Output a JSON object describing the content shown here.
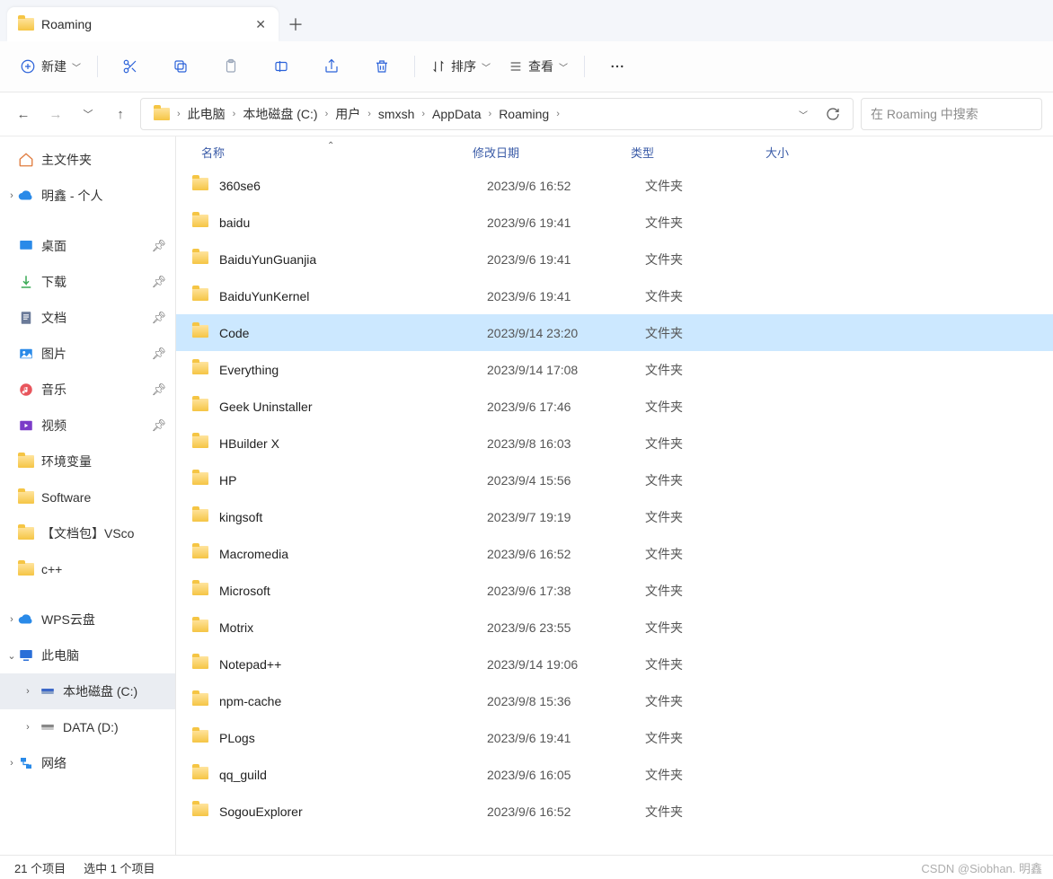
{
  "tab": {
    "title": "Roaming"
  },
  "toolbar": {
    "new": "新建",
    "sort": "排序",
    "view": "查看"
  },
  "breadcrumb": {
    "segments": [
      "此电脑",
      "本地磁盘 (C:)",
      "用户",
      "smxsh",
      "AppData",
      "Roaming"
    ]
  },
  "search": {
    "placeholder": "在 Roaming 中搜索"
  },
  "columns": {
    "name": "名称",
    "date": "修改日期",
    "type": "类型",
    "size": "大小"
  },
  "nav": {
    "home": "主文件夹",
    "personal": "明鑫 - 个人",
    "quick": [
      {
        "label": "桌面",
        "pinned": true
      },
      {
        "label": "下载",
        "pinned": true
      },
      {
        "label": "文档",
        "pinned": true
      },
      {
        "label": "图片",
        "pinned": true
      },
      {
        "label": "音乐",
        "pinned": true
      },
      {
        "label": "视频",
        "pinned": true
      },
      {
        "label": "环境变量",
        "pinned": false
      },
      {
        "label": "Software",
        "pinned": false
      },
      {
        "label": "【文档包】VSco",
        "pinned": false
      },
      {
        "label": "c++",
        "pinned": false
      }
    ],
    "wps": "WPS云盘",
    "thispc": "此电脑",
    "drive_c": "本地磁盘 (C:)",
    "drive_d": "DATA (D:)",
    "network": "网络"
  },
  "rows": [
    {
      "name": "360se6",
      "date": "2023/9/6 16:52",
      "type": "文件夹"
    },
    {
      "name": "baidu",
      "date": "2023/9/6 19:41",
      "type": "文件夹"
    },
    {
      "name": "BaiduYunGuanjia",
      "date": "2023/9/6 19:41",
      "type": "文件夹"
    },
    {
      "name": "BaiduYunKernel",
      "date": "2023/9/6 19:41",
      "type": "文件夹"
    },
    {
      "name": "Code",
      "date": "2023/9/14 23:20",
      "type": "文件夹",
      "selected": true
    },
    {
      "name": "Everything",
      "date": "2023/9/14 17:08",
      "type": "文件夹"
    },
    {
      "name": "Geek Uninstaller",
      "date": "2023/9/6 17:46",
      "type": "文件夹"
    },
    {
      "name": "HBuilder X",
      "date": "2023/9/8 16:03",
      "type": "文件夹"
    },
    {
      "name": "HP",
      "date": "2023/9/4 15:56",
      "type": "文件夹"
    },
    {
      "name": "kingsoft",
      "date": "2023/9/7 19:19",
      "type": "文件夹"
    },
    {
      "name": "Macromedia",
      "date": "2023/9/6 16:52",
      "type": "文件夹"
    },
    {
      "name": "Microsoft",
      "date": "2023/9/6 17:38",
      "type": "文件夹"
    },
    {
      "name": "Motrix",
      "date": "2023/9/6 23:55",
      "type": "文件夹"
    },
    {
      "name": "Notepad++",
      "date": "2023/9/14 19:06",
      "type": "文件夹"
    },
    {
      "name": "npm-cache",
      "date": "2023/9/8 15:36",
      "type": "文件夹"
    },
    {
      "name": "PLogs",
      "date": "2023/9/6 19:41",
      "type": "文件夹"
    },
    {
      "name": "qq_guild",
      "date": "2023/9/6 16:05",
      "type": "文件夹"
    },
    {
      "name": "SogouExplorer",
      "date": "2023/9/6 16:52",
      "type": "文件夹"
    }
  ],
  "status": {
    "count": "21 个项目",
    "selection": "选中 1 个项目"
  },
  "watermark": "CSDN @Siobhan. 明鑫"
}
